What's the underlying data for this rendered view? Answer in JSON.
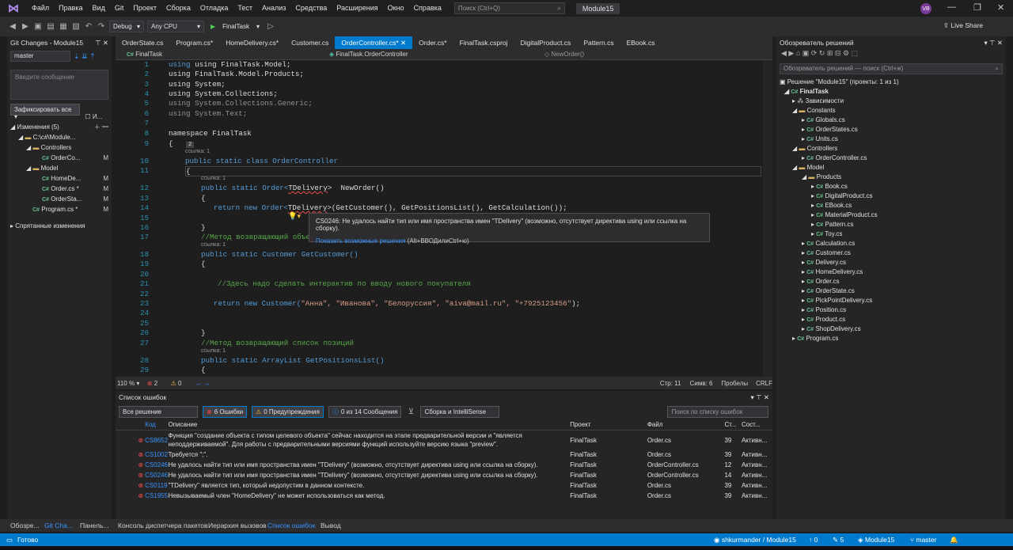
{
  "menu": {
    "items": [
      "Файл",
      "Правка",
      "Вид",
      "Git",
      "Проект",
      "Сборка",
      "Отладка",
      "Тест",
      "Анализ",
      "Средства",
      "Расширения",
      "Окно",
      "Справка"
    ],
    "search_placeholder": "Поиск (Ctrl+Q)",
    "solution": "Module15",
    "avatar": "VB"
  },
  "toolbar": {
    "config": "Debug",
    "platform": "Any CPU",
    "run": "FinalTask",
    "liveshare": "Live Share"
  },
  "git": {
    "title": "Git Changes - Module15",
    "branch": "master",
    "message_placeholder": "Введите сообщение",
    "commit": "Зафиксировать все",
    "amend": "И...",
    "changes": "Изменения (5)",
    "root": "C:\\c#\\Module...",
    "controllers": "Controllers",
    "model": "Model",
    "stashed": "Спрятанные изменения",
    "files": [
      {
        "name": "OrderCo...",
        "status": "M"
      },
      {
        "name": "HomeDe...",
        "status": "M"
      },
      {
        "name": "Order.cs *",
        "status": "M"
      },
      {
        "name": "OrderSta...",
        "status": "M"
      },
      {
        "name": "Program.cs *",
        "status": "M"
      }
    ]
  },
  "tabs": [
    "OrderState.cs",
    "Program.cs*",
    "HomeDelivery.cs*",
    "Customer.cs",
    "OrderController.cs*",
    "Order.cs*",
    "FinalTask.csproj",
    "DigitalProduct.cs",
    "Pattern.cs",
    "EBook.cs"
  ],
  "nav": {
    "project": "FinalTask",
    "class": "FinalTask.OrderController",
    "member": "NewOrder()"
  },
  "code": {
    "ref": "ссылка: 1",
    "l1": "using FinalTask.Model;",
    "l2": "using FinalTask.Model.Products;",
    "l3": "using System;",
    "l4": "using System.Collections;",
    "l5": "using System.Collections.Generic;",
    "l6": "using System.Text;",
    "l8": "namespace FinalTask",
    "l9": "{",
    "fold": "2",
    "l10": "public static class OrderController",
    "l11": "{",
    "l12a": "public static Order<",
    "l12b": "TDelivery",
    "l12c": ">  NewOrder()",
    "l13": "{",
    "l14a": "return new Order<",
    "l14b": "TDelivery",
    "l14c": ">(GetCustomer(), GetPositionsList(), GetCalculation());",
    "l16": "}",
    "l17": "//Метод возвращающий объек",
    "l18": "public static Customer GetCustomer()",
    "l19": "{",
    "l21": "//Здесь надо сделать интерактив по вводу нового покупателя",
    "l23a": "return new Customer(",
    "l23b": "\"Анна\", \"Иванова\", \"Белоруссия\", \"aiva@mail.ru\", \"+7925123456\"",
    "l23c": ");",
    "l26": "}",
    "l27": "//Метод возвращающий список позиций",
    "l28": "public static ArrayList GetPositionsList()",
    "l29": "{"
  },
  "tooltip": {
    "msg": "CS0246: Не удалось найти тип или имя пространства имен \"TDelivery\" (возможно, отсутствует директива using или ссылка на сборку).",
    "fix": "Показать возможные решения",
    "hint": " (Alt+ВВОДилиCtrl+ю)"
  },
  "editor_status": {
    "zoom": "110 %",
    "errors": "2",
    "warnings": "0",
    "line": "Стр: 11",
    "col": "Симв: 6",
    "spaces": "Пробелы",
    "eol": "CRLF"
  },
  "errorlist": {
    "title": "Список ошибок",
    "scope": "Все решение",
    "errors": "6 Ошибки",
    "warnings": "0 Предупреждения",
    "messages": "0 из 14 Сообщения",
    "build": "Сборка и IntelliSense",
    "search": "Поиск по списку ошибок",
    "headers": {
      "code": "Код",
      "desc": "Описание",
      "proj": "Проект",
      "file": "Файл",
      "line": "Ст...",
      "state": "Сост..."
    },
    "rows": [
      {
        "code": "CS8652",
        "desc": "Функция \"создание объекта с типом целевого объекта\" сейчас находится на этапе предварительной версии и \"является",
        "desc2": "неподдерживаемой\". Для работы с предварительными версиями функций используйте версию языка \"preview\".",
        "proj": "FinalTask",
        "file": "Order.cs",
        "line": "39",
        "state": "Активн..."
      },
      {
        "code": "CS1002",
        "desc": "Требуется \";\".",
        "proj": "FinalTask",
        "file": "Order.cs",
        "line": "39",
        "state": "Активн..."
      },
      {
        "code": "CS0246",
        "desc": "Не удалось найти тип или имя пространства имен \"TDelivery\" (возможно, отсутствует директива using или ссылка на сборку).",
        "proj": "FinalTask",
        "file": "OrderController.cs",
        "line": "12",
        "state": "Активн..."
      },
      {
        "code": "CS0246",
        "desc": "Не удалось найти тип или имя пространства имен \"TDelivery\" (возможно, отсутствует директива using или ссылка на сборку).",
        "proj": "FinalTask",
        "file": "OrderController.cs",
        "line": "14",
        "state": "Активн..."
      },
      {
        "code": "CS0119",
        "desc": "\"TDelivery\" является тип, который недопустим в данном контексте.",
        "proj": "FinalTask",
        "file": "Order.cs",
        "line": "39",
        "state": "Активн..."
      },
      {
        "code": "CS1955",
        "desc": "Невызываемый член \"HomeDelivery\" не может использоваться как метод.",
        "proj": "FinalTask",
        "file": "Order.cs",
        "line": "39",
        "state": "Активн..."
      }
    ]
  },
  "solution": {
    "title": "Обозреватель решений",
    "search": "Обозреватель решений — поиск (Ctrl+ж)",
    "items": [
      "Решение \"Module15\" (проекты: 1 из 1)",
      "FinalTask",
      "Зависимости",
      "Constants",
      "Globals.cs",
      "OrderStates.cs",
      "Units.cs",
      "Controllers",
      "OrderController.cs",
      "Model",
      "Products",
      "Book.cs",
      "DigitalProduct.cs",
      "EBook.cs",
      "MaterialProduct.cs",
      "Pattern.cs",
      "Toy.cs",
      "Calculation.cs",
      "Customer.cs",
      "Delivery.cs",
      "HomeDelivery.cs",
      "Order.cs",
      "OrderState.cs",
      "PickPointDelivery.cs",
      "Position.cs",
      "Product.cs",
      "ShopDelivery.cs",
      "Program.cs"
    ]
  },
  "bottomtabs": {
    "left": [
      "Обозре...",
      "Git Cha...",
      "Панель..."
    ],
    "center": [
      "Консоль диспетчера пакетов",
      "Иерархия вызовов",
      "Список ошибок",
      "Вывод"
    ]
  },
  "status": {
    "ready": "Готово",
    "repo": "shkurmander / Module15",
    "up": "0",
    "pencil": "5",
    "sol": "Module15",
    "branch": "master",
    "bell": "0"
  }
}
